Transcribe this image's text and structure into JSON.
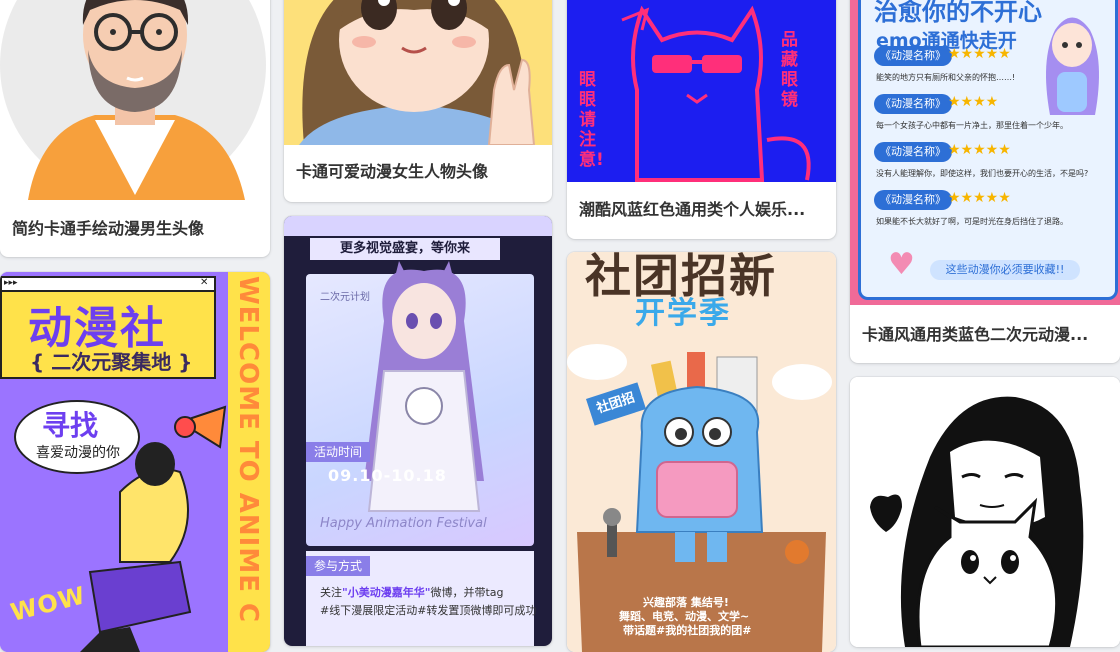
{
  "cards": [
    {
      "caption": "简约卡通手绘动漫男生头像"
    },
    {
      "caption": "卡通可爱动漫女生人物头像"
    },
    {
      "caption": "潮酷风蓝红色通用类个人娱乐...",
      "poster_text": {
        "side_right": "品藏眼镜",
        "side_left": "眼眼请注意!"
      }
    },
    {
      "caption": "卡通风通用类蓝色二次元动漫...",
      "poster_text": {
        "title": "治愈你的不开心",
        "subtitle": "emo通通快走开",
        "item_label": "《动漫名称》",
        "lines": [
          "能笑的地方只有厕所和父亲的怀抱……!",
          "每一个女孩子心中都有一片净土，那里住着一个少年。",
          "没有人能理解你，即使这样，我们也要开心的生活，不是吗?",
          "如果能不长大就好了啊，可是时光在身后挡住了退路。"
        ],
        "footer": "这些动漫你必须要收藏!!"
      }
    },
    {
      "poster_text": {
        "title": "动漫社",
        "subtitle": "{ 二次元聚集地 }",
        "bubble_big": "寻找",
        "bubble_small": "喜爱动漫的你",
        "side": "WELCOME TO ANIME C",
        "wow": "WOW"
      }
    },
    {
      "poster_text": {
        "top": "更多视觉盛宴，等你来",
        "corner": "二次元计划",
        "time_label": "活动时间",
        "time": "09.10-10.18",
        "script": "Happy Animation Festival",
        "join_label": "参与方式",
        "line1_pre": "关注",
        "line1_hl": "\"小美动漫嘉年华\"",
        "line1_post": "微博，并带tag",
        "line2": "#线下漫展限定活动#转发置顶微博即可成功"
      }
    },
    {
      "poster_text": {
        "title": "社团招新",
        "subtitle": "开学季",
        "flag": "社团招",
        "line1": "兴趣部落 集结号!",
        "line2": "舞蹈、电竞、动漫、文学~",
        "line3": "带话题#我的社团我的团#"
      }
    },
    {}
  ]
}
